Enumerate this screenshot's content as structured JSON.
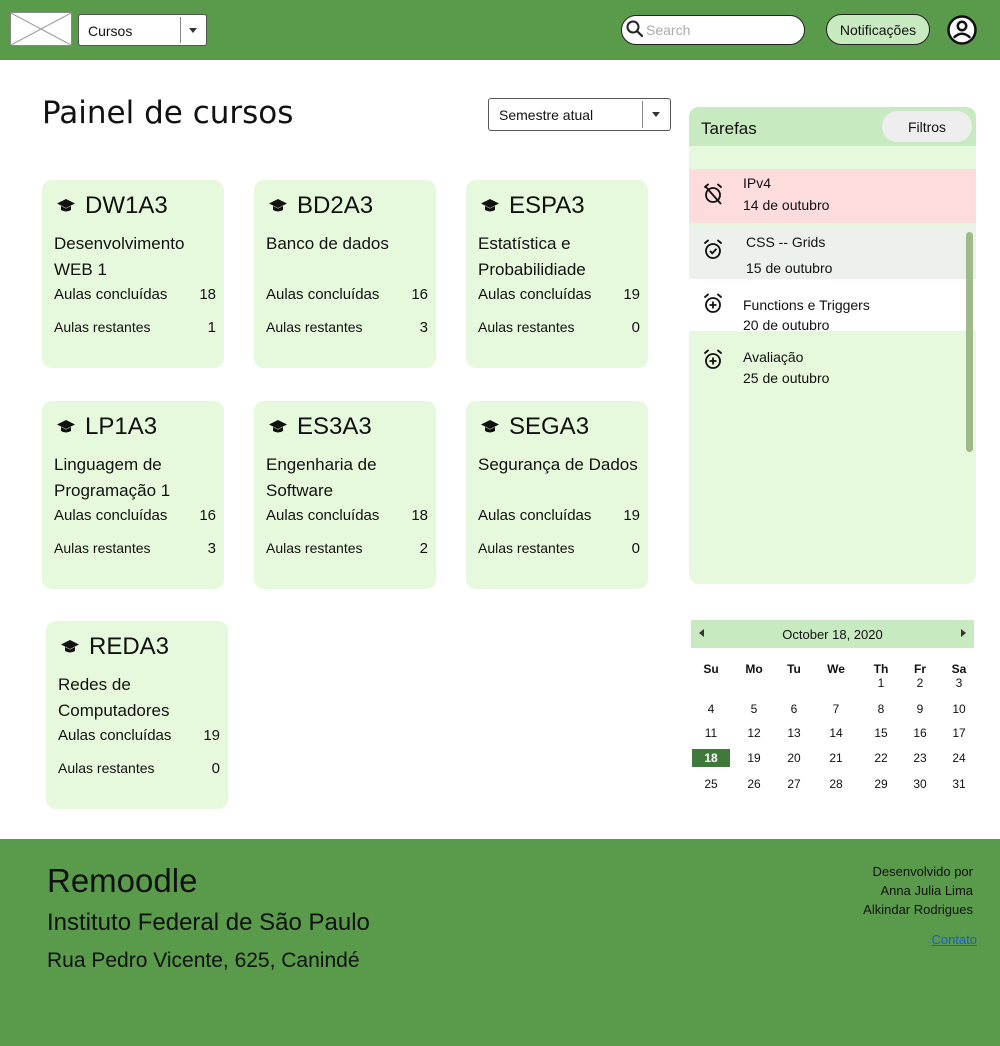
{
  "header": {
    "course_select_value": "Cursos",
    "search_placeholder": "Search",
    "notifications_label": "Notificações"
  },
  "main": {
    "title": "Painel de cursos",
    "semester_select_value": "Semestre atual"
  },
  "courses": [
    {
      "code": "DW1A3",
      "name": "Desenvolvimento WEB 1",
      "completed_label": "Aulas concluídas",
      "completed": "18",
      "remaining_label": "Aulas restantes",
      "remaining": "1"
    },
    {
      "code": "BD2A3",
      "name": "Banco de dados",
      "completed_label": "Aulas concluídas",
      "completed": "16",
      "remaining_label": "Aulas restantes",
      "remaining": "3"
    },
    {
      "code": "ESPA3",
      "name": "Estatística e Probabilidiade",
      "completed_label": "Aulas concluídas",
      "completed": "19",
      "remaining_label": "Aulas restantes",
      "remaining": "0"
    },
    {
      "code": "LP1A3",
      "name": "Linguagem de Programação 1",
      "completed_label": "Aulas concluídas",
      "completed": "16",
      "remaining_label": "Aulas restantes",
      "remaining": "3"
    },
    {
      "code": "ES3A3",
      "name": "Engenharia de Software",
      "completed_label": "Aulas concluídas",
      "completed": "18",
      "remaining_label": "Aulas restantes",
      "remaining": "2"
    },
    {
      "code": "SEGA3",
      "name": "Segurança de Dados",
      "completed_label": "Aulas concluídas",
      "completed": "19",
      "remaining_label": "Aulas restantes",
      "remaining": "0"
    },
    {
      "code": "REDA3",
      "name": "Redes de Computadores",
      "completed_label": "Aulas concluídas",
      "completed": "19",
      "remaining_label": "Aulas restantes",
      "remaining": "0"
    }
  ],
  "tasks": {
    "title": "Tarefas",
    "filter_label": "Filtros",
    "items": [
      {
        "name": "IPv4",
        "date": "14 de outubro",
        "status": "overdue",
        "icon": "alarm-off-icon",
        "color": "#fcdcdc"
      },
      {
        "name": "CSS -- Grids",
        "date": "15 de outubro",
        "status": "done",
        "icon": "alarm-check-icon",
        "color": "#edf1ec"
      },
      {
        "name": "Functions e Triggers",
        "date": "20 de outubro",
        "status": "pending",
        "icon": "alarm-add-icon",
        "color": "#ffffff"
      },
      {
        "name": "Avaliação",
        "date": "25 de outubro",
        "status": "pending",
        "icon": "alarm-add-icon",
        "color": "#e6f9dd"
      }
    ]
  },
  "calendar": {
    "title": "October 18, 2020",
    "weekdays": [
      "Su",
      "Mo",
      "Tu",
      "We",
      "Th",
      "Fr",
      "Sa"
    ],
    "days": [
      "1",
      "2",
      "3",
      "4",
      "5",
      "6",
      "7",
      "8",
      "9",
      "10",
      "11",
      "12",
      "13",
      "14",
      "15",
      "16",
      "17",
      "18",
      "19",
      "20",
      "21",
      "22",
      "23",
      "24",
      "25",
      "26",
      "27",
      "28",
      "29",
      "30",
      "31"
    ],
    "first_weekday_index": 4,
    "selected_day": "18",
    "selected_color": "#3f7a3a"
  },
  "footer": {
    "brand": "Remoodle",
    "institution": "Instituto Federal de São Paulo",
    "address": "Rua Pedro Vicente, 625, Canindé",
    "dev_label": "Desenvolvido por",
    "dev_names": [
      "Anna Julia Lima",
      "Alkindar Rodrigues"
    ],
    "contact_link": "Contato"
  },
  "colors": {
    "brand_green": "#5a9a4b",
    "card_bg": "#e6f9dd",
    "header_green_light": "#c8eac0"
  }
}
